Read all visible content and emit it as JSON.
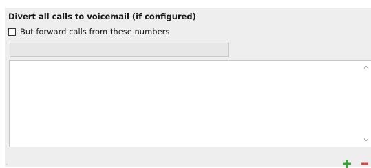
{
  "voicemail_section": {
    "heading": "Divert all calls to voicemail (if configured)",
    "forward_checkbox_label": "But forward calls from these numbers",
    "forward_checkbox_checked": false,
    "number_input_value": "",
    "number_list_items": []
  },
  "icons": {
    "add": "plus-icon",
    "remove": "minus-icon",
    "scroll_up": "chevron-up-icon",
    "scroll_down": "chevron-down-icon"
  },
  "colors": {
    "panel_bg": "#eeeeee",
    "add_green": "#3aa63a",
    "remove_red": "#d9463b",
    "border": "#c7c7c7"
  }
}
